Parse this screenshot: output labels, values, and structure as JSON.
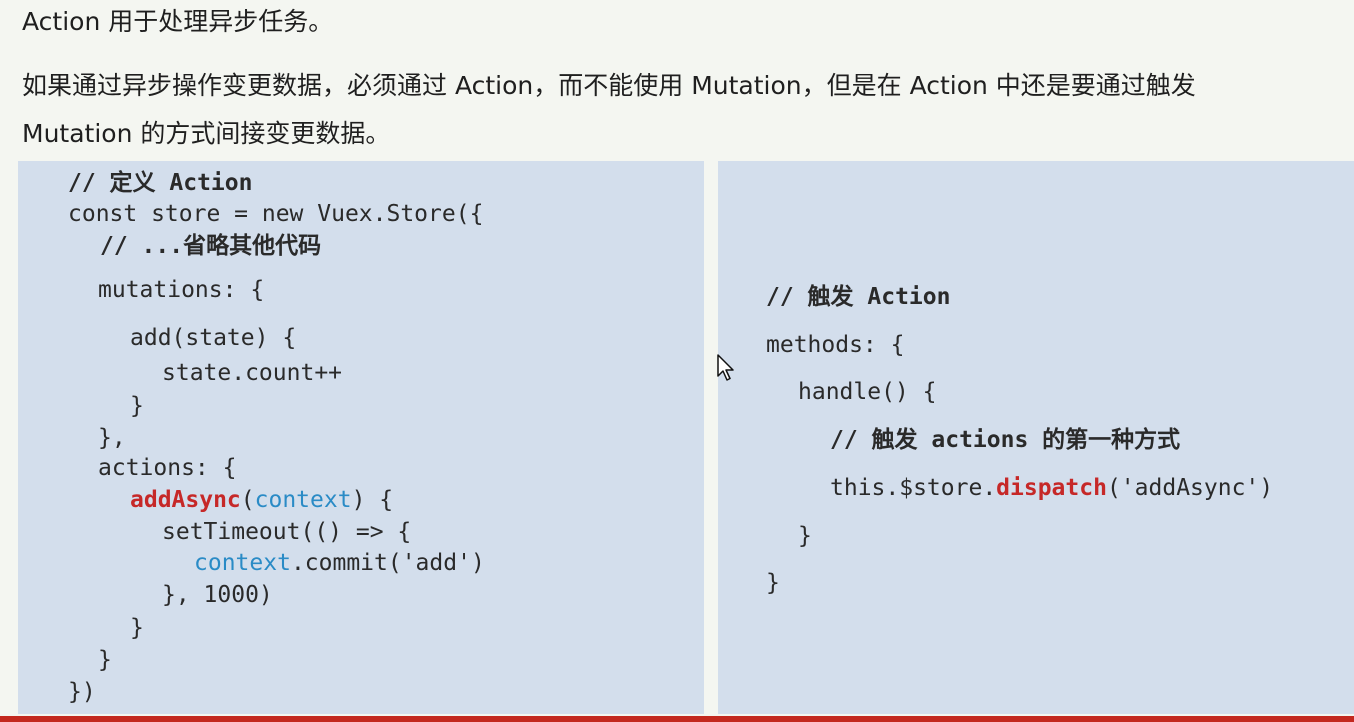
{
  "intro": {
    "line1": "Action 用于处理异步任务。",
    "line2": "如果通过异步操作变更数据，必须通过 Action，而不能使用 Mutation，但是在 Action 中还是要通过触发",
    "line3": "Mutation 的方式间接变更数据。"
  },
  "left_code": {
    "comment_define": "// 定义 Action",
    "store_open": "const store = new Vuex.Store({",
    "comment_omit": "// ...省略其他代码",
    "mutations_open": "mutations: {",
    "add_open": "add(state) {",
    "count_inc": "state.count++",
    "add_close": "}",
    "mutations_close": "},",
    "actions_open": "actions: {",
    "add_async_name": "addAsync",
    "add_async_paren_open": "(",
    "add_async_param": "context",
    "add_async_rest": ") {",
    "set_timeout_open": "setTimeout(() => {",
    "commit_obj": "context",
    "commit_call": ".commit('add')",
    "set_timeout_close": "}, 1000)",
    "add_async_close": "}",
    "actions_close": "}",
    "store_close": "})"
  },
  "right_code": {
    "comment_trigger": "// 触发 Action",
    "methods_open": "methods: {",
    "handle_open": "handle() {",
    "comment_first_way": "// 触发 actions 的第一种方式",
    "dispatch_prefix": "this.$store.",
    "dispatch_name": "dispatch",
    "dispatch_args": "('addAsync')",
    "handle_close": "}",
    "methods_close": "}"
  },
  "colors": {
    "panel_bg": "#d3deec",
    "keyword_red": "#c62828",
    "param_blue": "#2a8bc6",
    "bottom_bar": "#c3281e"
  },
  "icons": [
    "mouse-pointer-icon"
  ]
}
